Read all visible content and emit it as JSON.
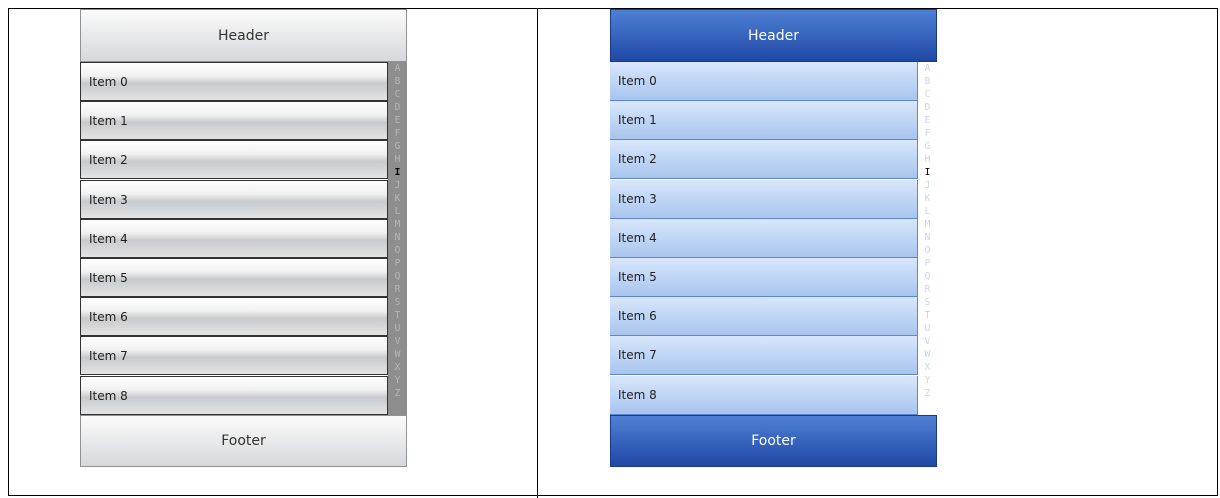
{
  "panels": [
    {
      "theme": "gray",
      "header": "Header",
      "footer": "Footer",
      "items": [
        "Item 0",
        "Item 1",
        "Item 2",
        "Item 3",
        "Item 4",
        "Item 5",
        "Item 6",
        "Item 7",
        "Item 8"
      ],
      "index_letters": [
        "A",
        "B",
        "C",
        "D",
        "E",
        "F",
        "G",
        "H",
        "I",
        "J",
        "K",
        "L",
        "M",
        "N",
        "O",
        "P",
        "Q",
        "R",
        "S",
        "T",
        "U",
        "V",
        "W",
        "X",
        "Y",
        "Z"
      ],
      "active_letter": "I"
    },
    {
      "theme": "blue",
      "header": "Header",
      "footer": "Footer",
      "items": [
        "Item 0",
        "Item 1",
        "Item 2",
        "Item 3",
        "Item 4",
        "Item 5",
        "Item 6",
        "Item 7",
        "Item 8"
      ],
      "index_letters": [
        "A",
        "B",
        "C",
        "D",
        "E",
        "F",
        "G",
        "H",
        "I",
        "J",
        "K",
        "L",
        "M",
        "N",
        "O",
        "P",
        "Q",
        "R",
        "S",
        "T",
        "U",
        "V",
        "W",
        "X",
        "Y",
        "Z"
      ],
      "active_letter": "I"
    }
  ],
  "colors": {
    "gray_header": "#d7d8da",
    "blue_header": "#1f48a5",
    "blue_item": "#c4d9f6"
  }
}
